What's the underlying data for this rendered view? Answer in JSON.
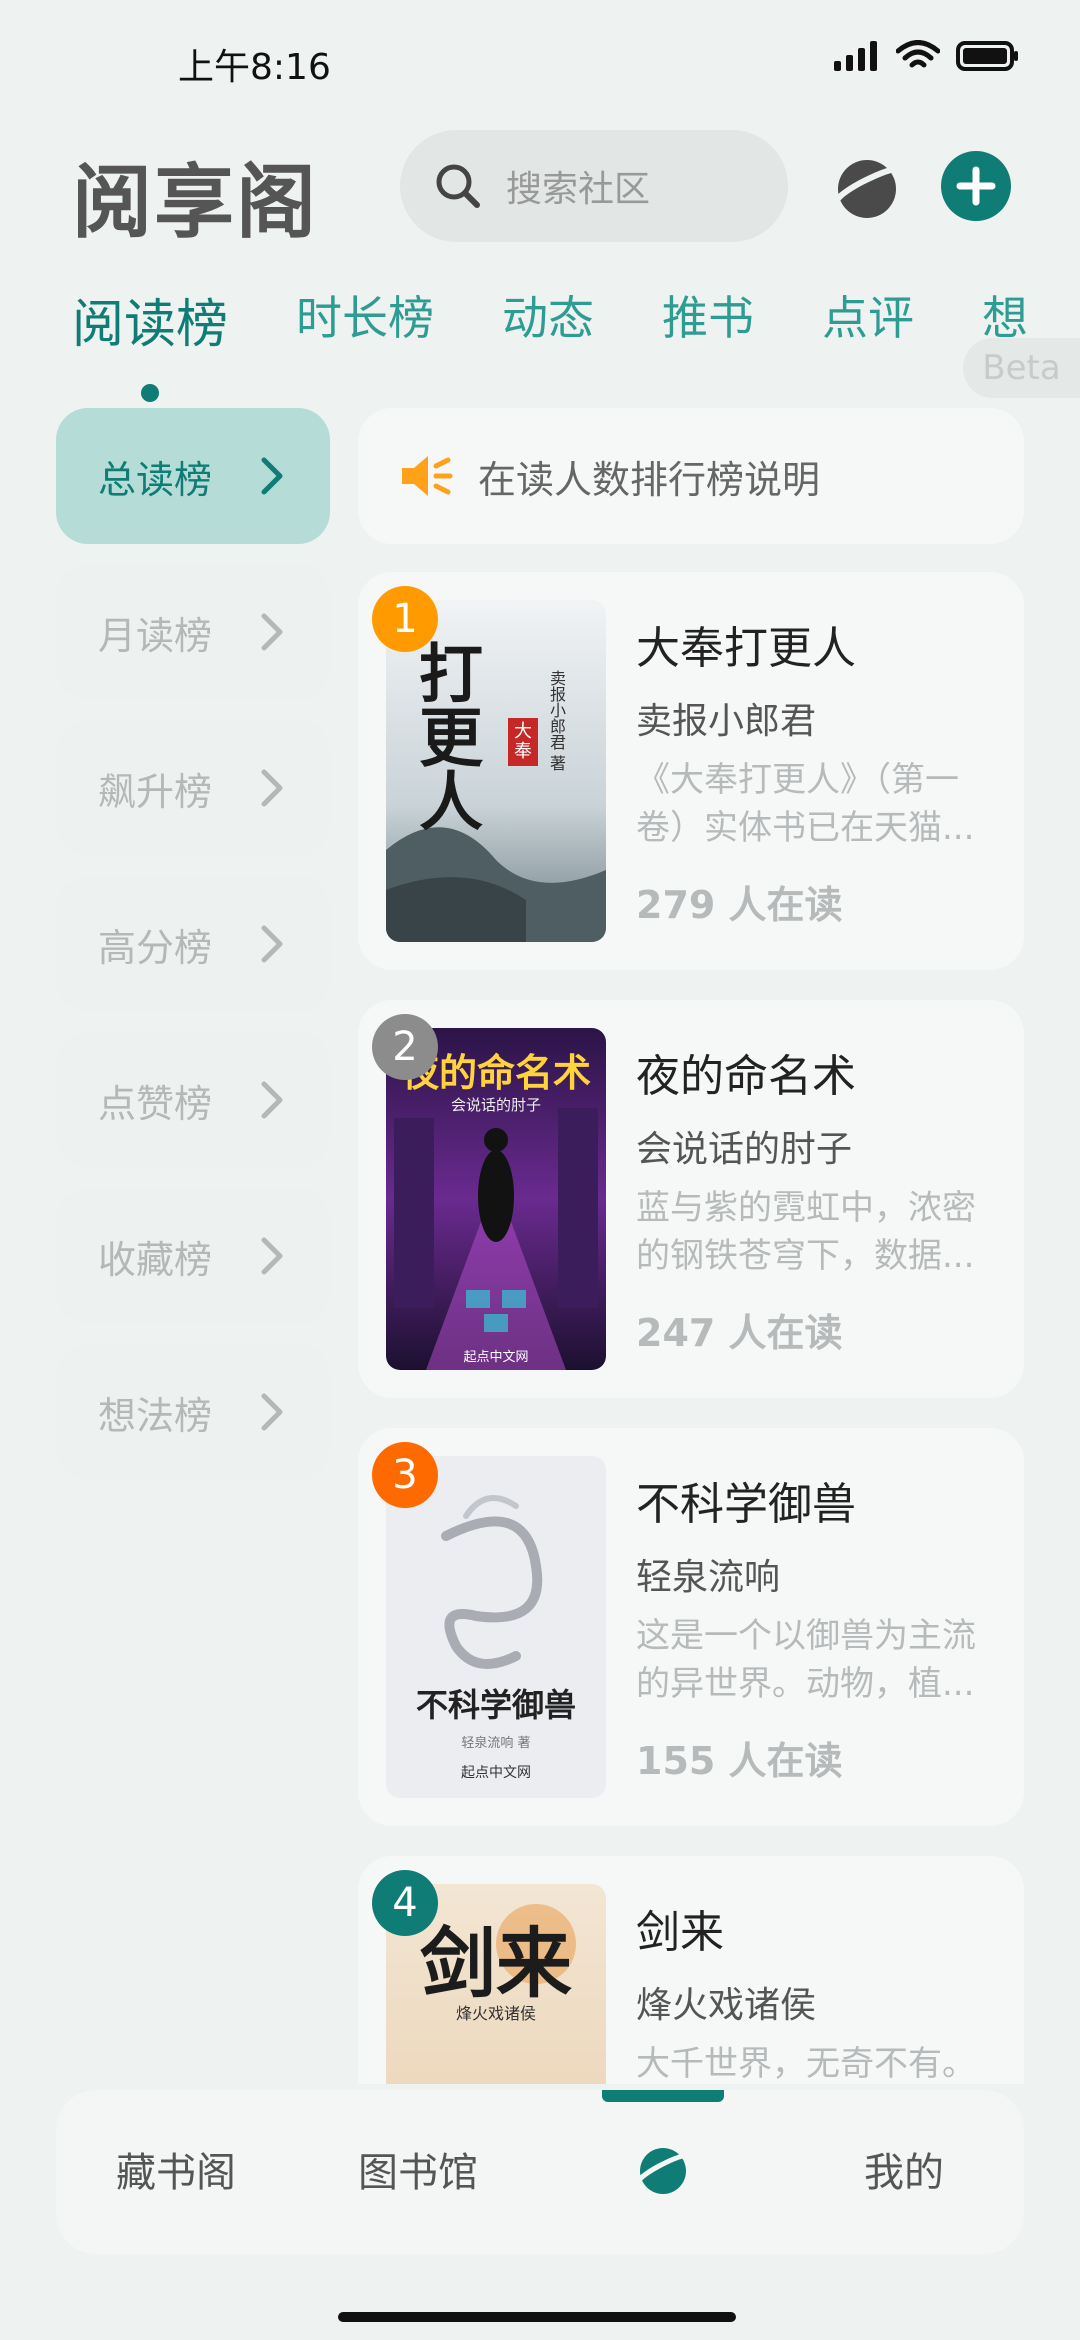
{
  "status": {
    "time": "上午8:16"
  },
  "header": {
    "title": "阅享阁",
    "search_placeholder": "搜索社区"
  },
  "tabs": [
    "阅读榜",
    "时长榜",
    "动态",
    "推书",
    "点评",
    "想"
  ],
  "beta_label": "Beta",
  "categories": [
    {
      "label": "总读榜",
      "active": true
    },
    {
      "label": "月读榜"
    },
    {
      "label": "飙升榜"
    },
    {
      "label": "高分榜"
    },
    {
      "label": "点赞榜"
    },
    {
      "label": "收藏榜"
    },
    {
      "label": "想法榜"
    }
  ],
  "notice": {
    "text": "在读人数排行榜说明"
  },
  "books": [
    {
      "rank": "1",
      "rank_color": "#ff9a00",
      "title": "大奉打更人",
      "author": "卖报小郎君",
      "desc": "《大奉打更人》（第一卷）实体书已在天猫...",
      "readers": "279 人在读",
      "cover_text": "打更人",
      "cover_sub": "大奉",
      "cover_author": "卖报小郎君 著"
    },
    {
      "rank": "2",
      "rank_color": "#8c8c8c",
      "title": "夜的命名术",
      "author": "会说话的肘子",
      "desc": "蓝与紫的霓虹中，浓密的钢铁苍穹下，数据...",
      "readers": "247 人在读",
      "cover_text": "夜的命名术",
      "cover_author": "会说话的肘子",
      "cover_pub": "起点中文网"
    },
    {
      "rank": "3",
      "rank_color": "#ff6a00",
      "title": "不科学御兽",
      "author": "轻泉流响",
      "desc": "这是一个以御兽为主流的异世界。动物，植...",
      "readers": "155 人在读",
      "cover_text": "不科学御兽",
      "cover_author": "轻泉流响 著",
      "cover_pub": "起点中文网"
    },
    {
      "rank": "4",
      "rank_color": "#0f7d75",
      "title": "剑来",
      "author": "烽火戏诸侯",
      "desc": "大千世界，无奇不有。",
      "readers": "",
      "cover_text": "剑来",
      "cover_author": "烽火戏诸侯"
    }
  ],
  "bottom_nav": [
    "藏书阁",
    "图书馆",
    "社区",
    "我的"
  ],
  "colors": {
    "accent": "#0f7d75"
  }
}
